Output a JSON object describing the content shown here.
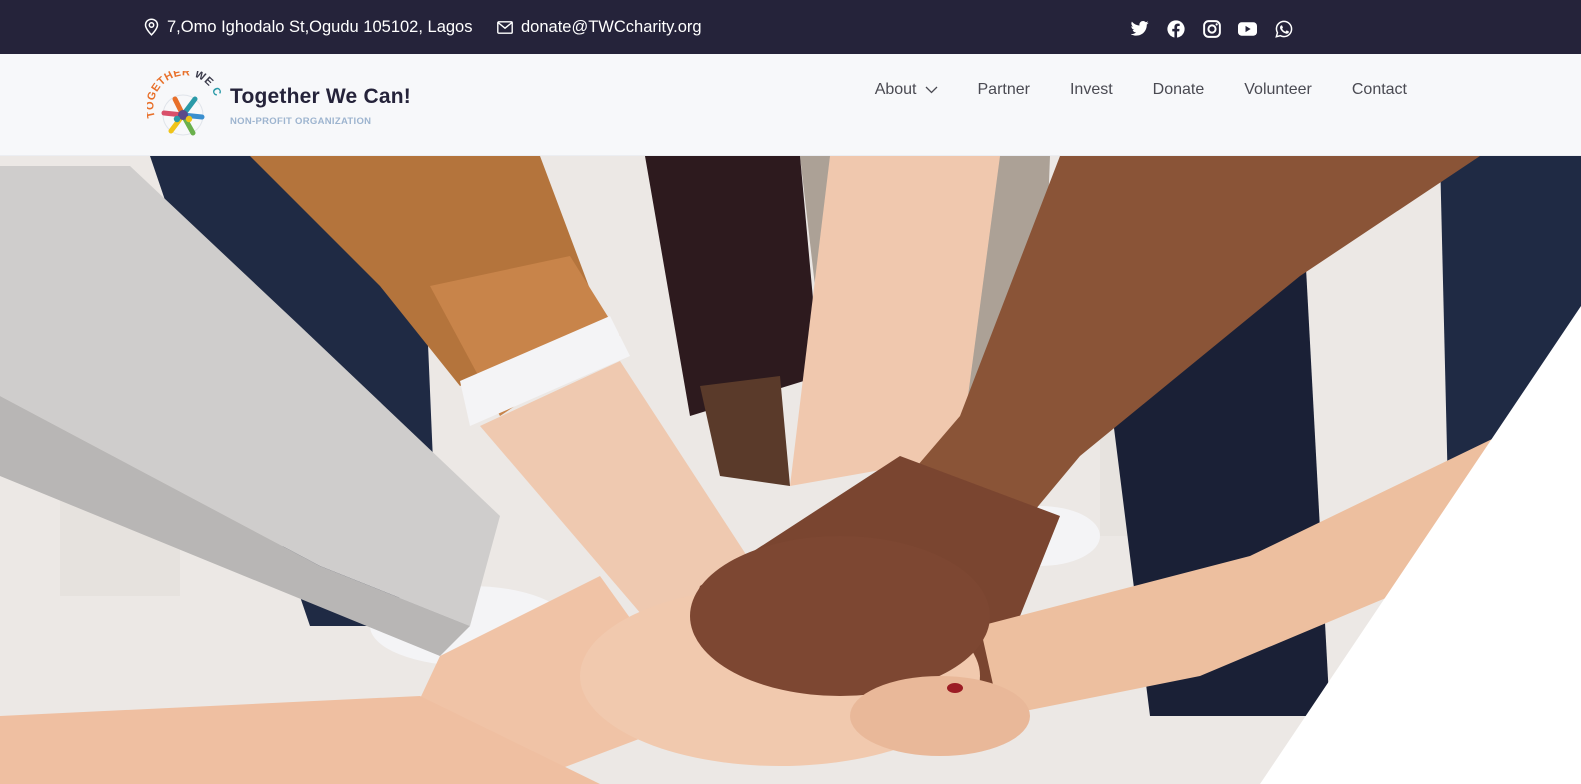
{
  "topbar": {
    "address": "7,Omo Ighodalo St,Ogudu 105102, Lagos",
    "email": "donate@TWCcharity.org",
    "address_icon": "location-pin-icon",
    "email_icon": "envelope-icon",
    "socials": [
      "twitter-icon",
      "facebook-icon",
      "instagram-icon",
      "youtube-icon",
      "whatsapp-icon"
    ]
  },
  "brand": {
    "name": "Together We Can!",
    "tagline": "NON-PROFIT ORGANIZATION",
    "logo_text": "TOGETHER WE CAN"
  },
  "nav": {
    "items": [
      {
        "label": "About",
        "has_dropdown": true
      },
      {
        "label": "Partner"
      },
      {
        "label": "Invest"
      },
      {
        "label": "Donate"
      },
      {
        "label": "Volunteer"
      },
      {
        "label": "Contact"
      }
    ]
  },
  "colors": {
    "topbar_bg": "#25233a",
    "header_bg": "#f7f8fa",
    "brand_text": "#25233a",
    "tagline": "#9db4cf",
    "nav_text": "#4a4a52"
  }
}
